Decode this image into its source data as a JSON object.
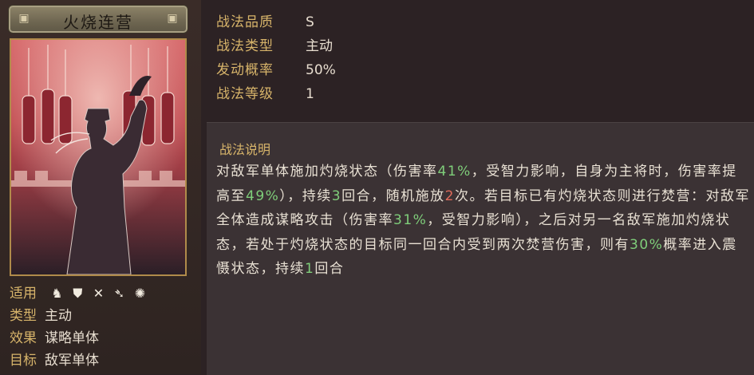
{
  "skill": {
    "name": "火烧连营",
    "stats": [
      {
        "label": "战法品质",
        "value": "S"
      },
      {
        "label": "战法类型",
        "value": "主动"
      },
      {
        "label": "发动概率",
        "value": "50%"
      },
      {
        "label": "战法等级",
        "value": "1"
      }
    ],
    "info": {
      "apply_label": "适用",
      "type_label": "类型",
      "type_value": "主动",
      "effect_label": "效果",
      "effect_value": "谋略单体",
      "target_label": "目标",
      "target_value": "敌军单体",
      "weapon_icons": [
        "cavalry-icon",
        "shield-icon",
        "spear-icon",
        "bow-icon",
        "wheel-icon"
      ]
    },
    "description": {
      "title": "战法说明",
      "segments": [
        {
          "t": "对敌军单体施加灼烧状态（伤害率"
        },
        {
          "t": "41%",
          "c": "g"
        },
        {
          "t": "，受智力影响，自身为主将时，伤害率提高至"
        },
        {
          "t": "49%",
          "c": "g"
        },
        {
          "t": "），持续"
        },
        {
          "t": "3",
          "c": "g"
        },
        {
          "t": "回合，随机施放"
        },
        {
          "t": "2",
          "c": "r"
        },
        {
          "t": "次。若目标已有灼烧状态则进行焚营：对敌军全体造成谋略攻击（伤害率"
        },
        {
          "t": "31%",
          "c": "g"
        },
        {
          "t": "，受智力影响），之后对另一名敌军施加灼烧状态，若处于灼烧状态的目标同一回合内受到两次焚营伤害，则有"
        },
        {
          "t": "30%",
          "c": "g"
        },
        {
          "t": "概率进入震慑状态，持续"
        },
        {
          "t": "1",
          "c": "g"
        },
        {
          "t": "回合"
        }
      ]
    }
  },
  "colors": {
    "label_gold": "#d7b46a",
    "value_text": "#e7ddcf",
    "highlight_green": "#7fce7a",
    "highlight_red": "#e06a5a"
  }
}
